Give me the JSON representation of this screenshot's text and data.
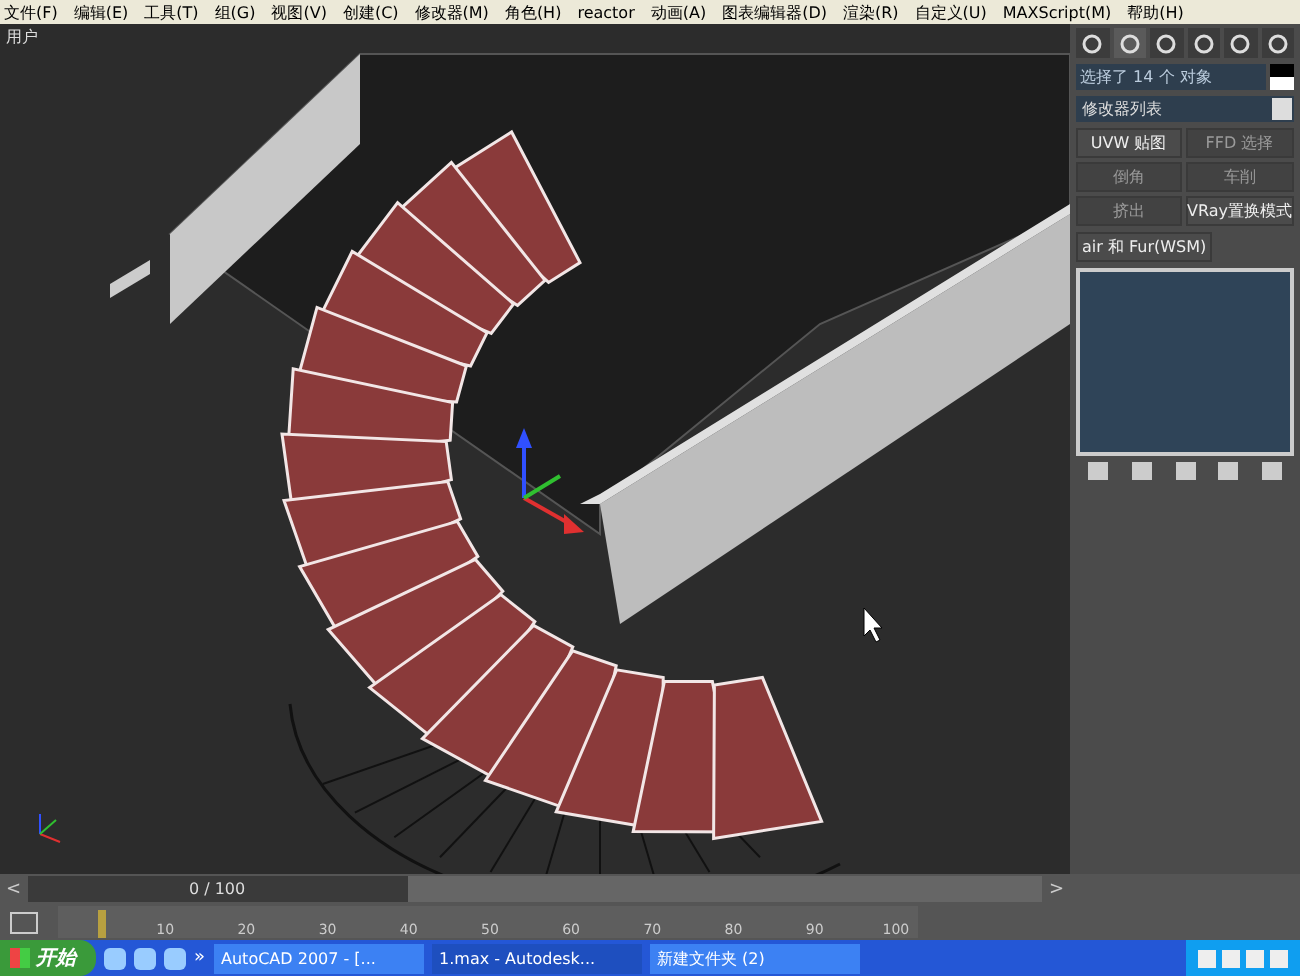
{
  "menu_bar": {
    "items": [
      "文件(F)",
      "编辑(E)",
      "工具(T)",
      "组(G)",
      "视图(V)",
      "创建(C)",
      "修改器(M)",
      "角色(H)",
      "reactor",
      "动画(A)",
      "图表编辑器(D)",
      "渲染(R)",
      "自定义(U)",
      "MAXScript(M)",
      "帮助(H)"
    ]
  },
  "viewport": {
    "label": "用户"
  },
  "command_panel": {
    "selection": "选择了 14 个 对象",
    "modifier_list": "修改器列表",
    "buttons": [
      {
        "label": "UVW 贴图",
        "disabled": false
      },
      {
        "label": "FFD 选择",
        "disabled": true
      },
      {
        "label": "倒角",
        "disabled": true
      },
      {
        "label": "车削",
        "disabled": true
      },
      {
        "label": "挤出",
        "disabled": true
      },
      {
        "label": "VRay置换模式",
        "disabled": false
      }
    ],
    "tab_label": "air 和 Fur(WSM)"
  },
  "time_slider": {
    "position": "0 / 100",
    "prev": "<",
    "next": ">",
    "level": 0
  },
  "track_bar": {
    "ticks": [
      "10",
      "20",
      "30",
      "40",
      "50",
      "60",
      "70",
      "80",
      "90",
      "100"
    ]
  },
  "taskbar": {
    "start": "开始",
    "more": "»",
    "tasks": [
      {
        "label": "AutoCAD 2007 - [...",
        "selected": false
      },
      {
        "label": "1.max - Autodesk...",
        "selected": true
      },
      {
        "label": "新建文件夹 (2)",
        "selected": false
      }
    ]
  }
}
